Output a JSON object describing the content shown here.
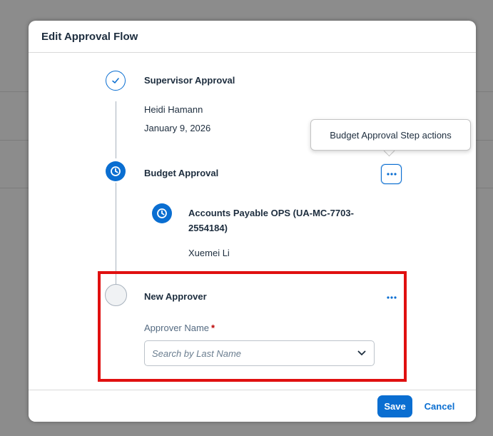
{
  "dialog": {
    "title": "Edit Approval Flow"
  },
  "steps": [
    {
      "title": "Supervisor Approval",
      "status_icon": "check-icon",
      "approver": "Heidi Hamann",
      "date": "January 9, 2026"
    },
    {
      "title": "Budget Approval",
      "status_icon": "clock-icon",
      "sub_step": {
        "title_line1": "Accounts Payable OPS (UA-MC-7703-",
        "title_line2": "2554184)",
        "status_icon": "clock-icon",
        "approver": "Xuemei Li"
      },
      "actions_icon": "more-horizontal-icon"
    },
    {
      "title": "New Approver",
      "status_icon": "empty-circle-icon",
      "field_label": "Approver Name",
      "required_mark": "*",
      "input_placeholder": "Search by Last Name",
      "input_value": "",
      "actions_icon": "more-horizontal-icon"
    }
  ],
  "tooltip": {
    "text": "Budget Approval Step actions"
  },
  "footer": {
    "save_label": "Save",
    "cancel_label": "Cancel"
  },
  "colors": {
    "accent": "#0a6ed1",
    "highlight": "#e01010",
    "overlay": "#8c8c8c",
    "required": "#bb0000"
  }
}
